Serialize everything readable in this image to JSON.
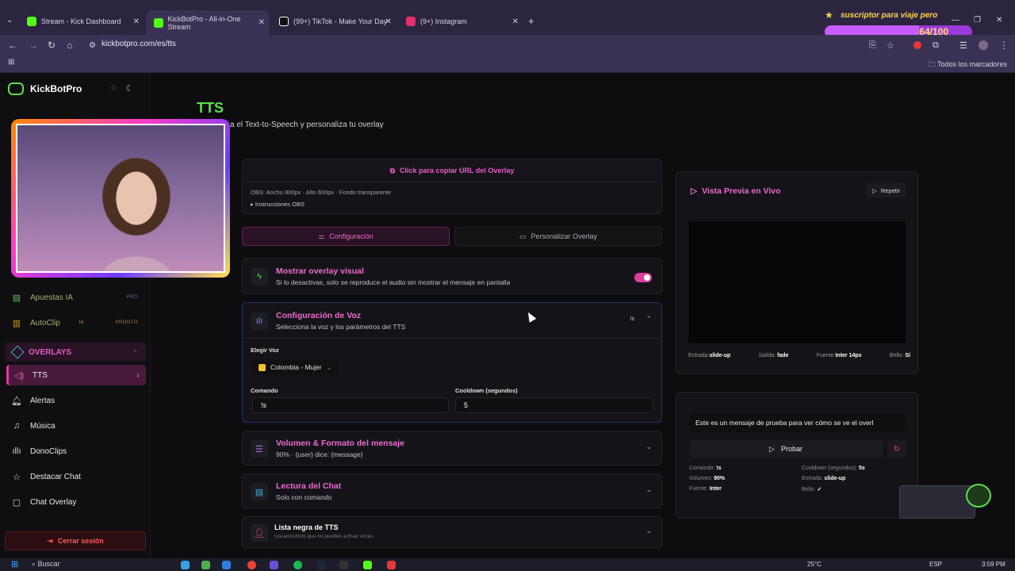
{
  "browser": {
    "tabs": [
      {
        "label": "Stream - Kick Dashboard",
        "favicon_color": "#53fc18"
      },
      {
        "label": "KickBotPro - All-in-One Stream",
        "favicon_color": "#53fc18"
      },
      {
        "label": "(99+) TikTok - Make Your Day",
        "favicon_color": "#111111"
      },
      {
        "label": "(9+) Instagram",
        "favicon_color": "#e1306c"
      }
    ],
    "url": "kickbotpro.com/es/tts",
    "bookmarks_label": "Todos los marcadores"
  },
  "stream_overlay": {
    "title": "suscriptor para viaje pero",
    "count": "64/100",
    "progress": 0.64
  },
  "sidebar": {
    "brand": "KickBotPro",
    "items_top": [
      {
        "label": "Apuestas IA",
        "tag": "PRO"
      },
      {
        "label": "AutoClip",
        "tag": "PRONTO",
        "mid_tag": "IA"
      }
    ],
    "group_label": "OVERLAYS",
    "items": [
      {
        "label": "TTS"
      },
      {
        "label": "Alertas"
      },
      {
        "label": "Música"
      },
      {
        "label": "DonoClips"
      },
      {
        "label": "Destacar Chat"
      },
      {
        "label": "Chat Overlay"
      }
    ],
    "logout": "Cerrar sesión"
  },
  "page": {
    "title": "TTS",
    "subtitle": "a el Text-to-Speech y personaliza tu overlay"
  },
  "overlay_url": {
    "copy_label": "Click para copiar URL del Overlay",
    "obs_info": "OBS: Ancho 800px · Alto 600px · Fondo transparente",
    "obs_instructions": "Instrucciones OBS"
  },
  "tabs": {
    "config": "Configuración",
    "customize": "Personalizar Overlay"
  },
  "sections": {
    "overlay_visual": {
      "title": "Mostrar overlay visual",
      "subtitle": "Si lo desactivas, solo se reproduce el audio sin mostrar el mensaje en pantalla",
      "enabled": true
    },
    "voice": {
      "title": "Configuración de Voz",
      "subtitle": "Selecciona la voz y los parámetros del TTS",
      "badge": "!s",
      "voice_label": "Elegir Voz",
      "voice_value": "Colombia - Mujer",
      "command_label": "Comando",
      "command_value": "!s",
      "cooldown_label": "Cooldown (segundos)",
      "cooldown_value": "5"
    },
    "volume": {
      "title": "Volumen & Formato del mensaje",
      "subtitle": "90% · {user} dice: {message}"
    },
    "chat": {
      "title": "Lectura del Chat",
      "subtitle": "Solo con comando"
    },
    "blacklist": {
      "title": "Lista negra de TTS",
      "subtitle": "Usuarios/bots que no pueden activar voces"
    }
  },
  "preview": {
    "title": "Vista Previa en Vivo",
    "repeat": "Repetir",
    "stats": [
      {
        "key": "Entrada:",
        "value": "slide-up"
      },
      {
        "key": "Salida:",
        "value": "fade"
      },
      {
        "key": "Fuente:",
        "value": "Inter 14px"
      },
      {
        "key": "Brillo:",
        "value": "Sí"
      }
    ]
  },
  "test": {
    "message": "Este es un mensaje de prueba para ver cómo se ve el overl",
    "button": "Probar",
    "info": {
      "command_key": "Comando:",
      "command_val": "!s",
      "volume_key": "Volumen:",
      "volume_val": "90%",
      "font_key": "Fuente:",
      "font_val": "Inter",
      "cooldown_key": "Cooldown (segundos):",
      "cooldown_val": "5s",
      "entry_key": "Entrada:",
      "entry_val": "slide-up",
      "glow_key": "Brillo:",
      "glow_val": "✓"
    }
  },
  "taskbar": {
    "search": "Buscar",
    "weather": "25°C",
    "lang": "ESP",
    "time": "3:59 PM"
  },
  "colors": {
    "accent_pink": "#ee6ad0",
    "brand_green": "#5be04a",
    "logout_red": "#ff5a5a"
  }
}
